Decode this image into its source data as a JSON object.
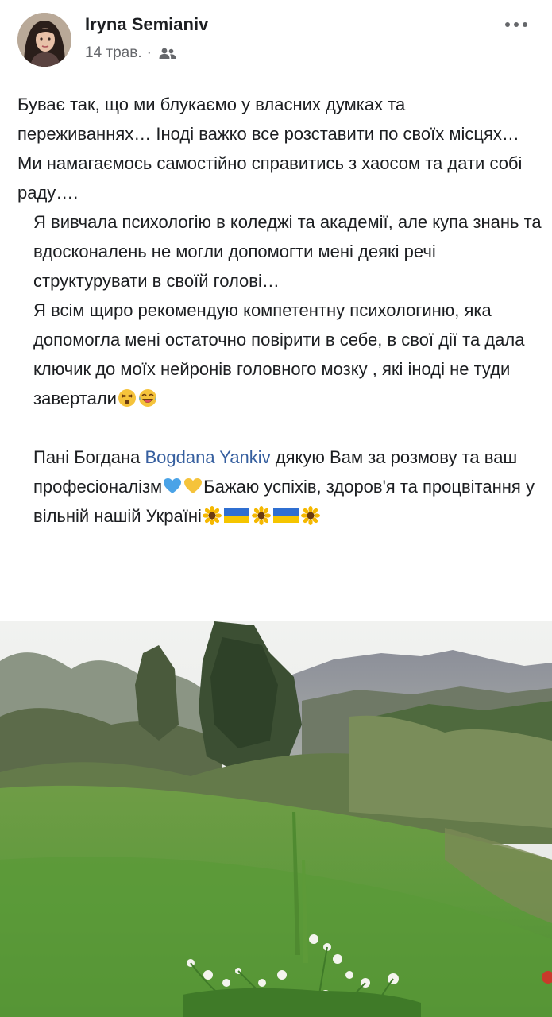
{
  "post": {
    "author_name": "Iryna Semianiv",
    "date": "14 трав.",
    "separator": "·",
    "audience_icon": "friends-icon",
    "more_icon": "more-options-icon",
    "paragraphs": {
      "p1": "Буває так, що ми блукаємо у власних думках та переживаннях… Іноді важко все розставити по своїх місцях…Ми намагаємось самостійно справитись з хаосом та дати собі раду….",
      "p2": "Я вивчала психологію в коледжі та академії, але купа знань та вдосконалень не могли допомогти мені деякі речі структурувати в своїй голові…",
      "p3": "Я всім щиро рекомендую компетентну психологиню, яка допомогла мені остаточно повірити в себе, в свої дії та дала ключик до моїх нейронів головного мозку , які іноді не туди завертали",
      "p4_start": "Пані Богдана ",
      "p4_mention": "Bogdana Yankiv",
      "p4_mid": " дякую Вам за розмову та ваш професіоналізм",
      "p4_end": "Бажаю успіхів, здоров'я та процвітання у вільній нашій Україні"
    },
    "emojis": {
      "p3": [
        "dizzy-face-emoji",
        "laughing-face-emoji"
      ],
      "p4_hearts": [
        "blue-heart-emoji",
        "yellow-heart-emoji"
      ],
      "p4_end": [
        "sunflower-emoji",
        "ukraine-flag-emoji",
        "sunflower-emoji",
        "ukraine-flag-emoji",
        "sunflower-emoji"
      ]
    },
    "photo": {
      "subject": "mountain-landscape-photo"
    },
    "colors": {
      "mention": "#365f9f",
      "meta": "#65676b",
      "text": "#1c1e21"
    }
  }
}
